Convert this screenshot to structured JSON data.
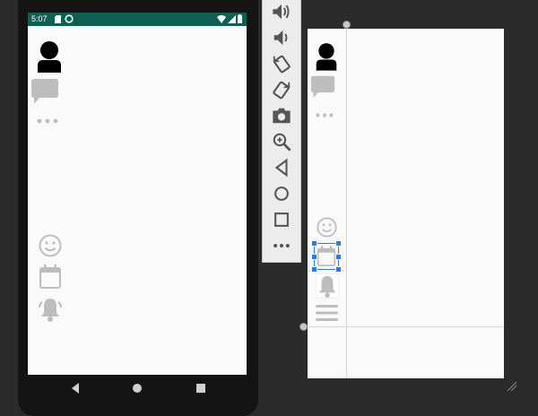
{
  "emulator": {
    "status_bar": {
      "time": "5:07"
    },
    "screen_icons": [
      "avatar-icon",
      "chat-bubble-icon",
      "more-dots-icon",
      "smiley-icon",
      "calendar-icon",
      "alarm-bell-icon"
    ],
    "nav_buttons": [
      "back-icon",
      "home-icon",
      "overview-icon"
    ]
  },
  "toolbar": {
    "buttons": [
      "volume-up-icon",
      "volume-down-icon",
      "rotate-left-icon",
      "rotate-right-icon",
      "camera-icon",
      "zoom-icon",
      "back-icon",
      "home-icon",
      "overview-icon",
      "more-icon"
    ]
  },
  "editor": {
    "preview_icons": [
      "avatar-icon",
      "chat-bubble-icon",
      "more-dots-icon",
      "smiley-icon",
      "calendar-icon",
      "alarm-bell-icon",
      "menu-lines-icon"
    ],
    "selected_view": "calendar-icon"
  },
  "colors": {
    "status_bar": "#0f5f54",
    "selection": "#2b7bd8",
    "workspace": "#2b2b2b",
    "icon_gray": "#bdbdbd"
  }
}
